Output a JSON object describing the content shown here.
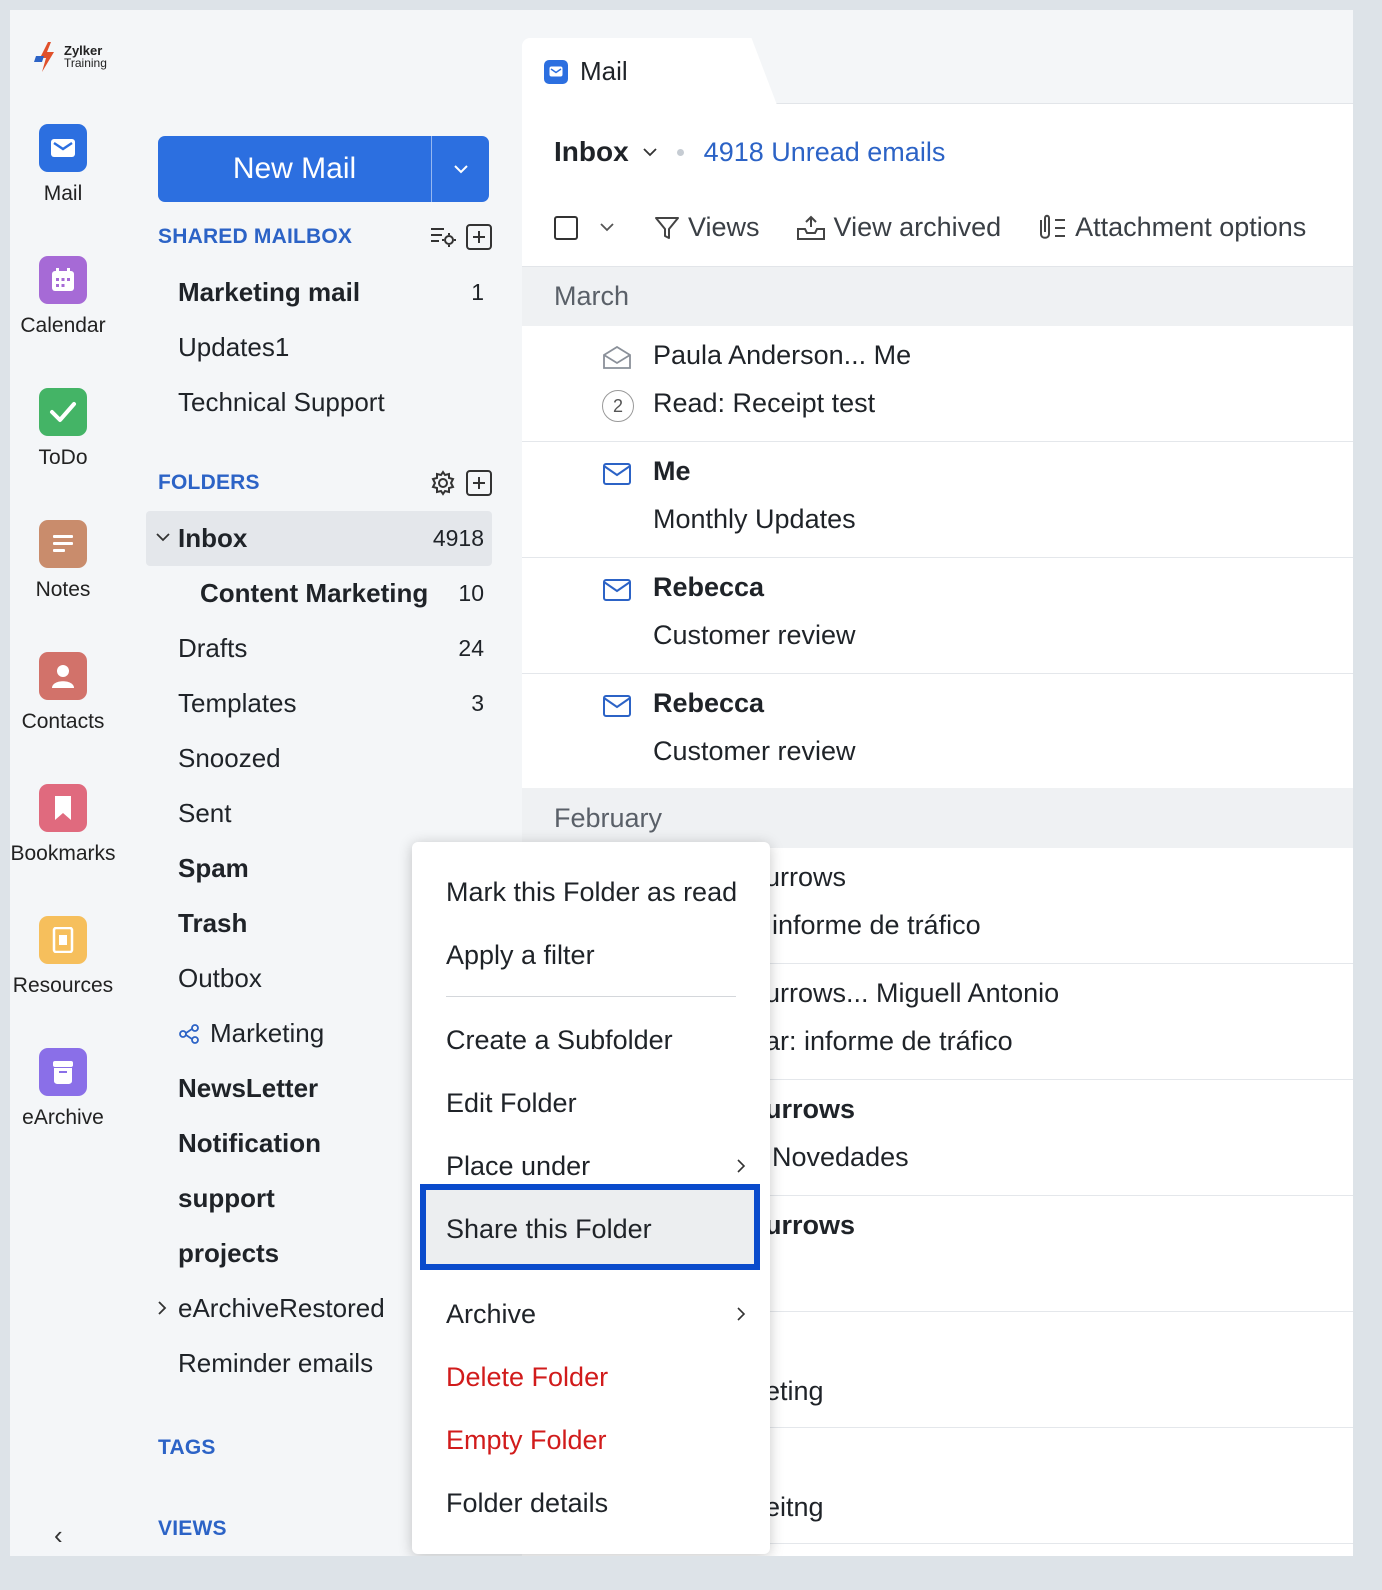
{
  "logo": {
    "line1": "Zylker",
    "line2": "Training"
  },
  "apps": [
    {
      "label": "Mail",
      "icon": "mail-icon",
      "color": "#2c6fe0"
    },
    {
      "label": "Calendar",
      "icon": "calendar-icon",
      "color": "#a66ad6"
    },
    {
      "label": "ToDo",
      "icon": "check-icon",
      "color": "#44b466"
    },
    {
      "label": "Notes",
      "icon": "notes-icon",
      "color": "#c98c6c"
    },
    {
      "label": "Contacts",
      "icon": "contact-icon",
      "color": "#d2726a"
    },
    {
      "label": "Bookmarks",
      "icon": "bookmark-icon",
      "color": "#e06a7e"
    },
    {
      "label": "Resources",
      "icon": "resources-icon",
      "color": "#f6bf5c"
    },
    {
      "label": "eArchive",
      "icon": "archive-icon",
      "color": "#8a6fe8"
    }
  ],
  "new_mail": {
    "label": "New Mail"
  },
  "shared_mailbox": {
    "heading": "SHARED MAILBOX",
    "items": [
      {
        "name": "Marketing mail",
        "count": "1"
      },
      {
        "name": "Updates1",
        "count": ""
      },
      {
        "name": "Technical Support",
        "count": ""
      }
    ]
  },
  "folders": {
    "heading": "FOLDERS",
    "items": [
      {
        "name": "Inbox",
        "count": "4918"
      },
      {
        "name": "Content Marketing",
        "count": "10"
      },
      {
        "name": "Drafts",
        "count": "24"
      },
      {
        "name": "Templates",
        "count": "3"
      },
      {
        "name": "Snoozed",
        "count": ""
      },
      {
        "name": "Sent",
        "count": ""
      },
      {
        "name": "Spam",
        "count": ""
      },
      {
        "name": "Trash",
        "count": ""
      },
      {
        "name": "Outbox",
        "count": ""
      },
      {
        "name": "Marketing",
        "count": ""
      },
      {
        "name": "NewsLetter",
        "count": ""
      },
      {
        "name": "Notification",
        "count": ""
      },
      {
        "name": "support",
        "count": ""
      },
      {
        "name": "projects",
        "count": ""
      },
      {
        "name": "eArchiveRestored",
        "count": ""
      },
      {
        "name": "Reminder emails",
        "count": ""
      }
    ]
  },
  "tags_heading": "TAGS",
  "views_heading": "VIEWS",
  "tab": {
    "label": "Mail"
  },
  "header": {
    "folder": "Inbox",
    "unread": "4918 Unread emails"
  },
  "toolbar": {
    "views": "Views",
    "archived": "View archived",
    "attachments": "Attachment options"
  },
  "groups": {
    "march": "March",
    "february": "February"
  },
  "mails": [
    {
      "sender": "Paula Anderson... Me",
      "subject": "Read: Receipt test",
      "count": "2"
    },
    {
      "sender": "Me",
      "subject": "Monthly Updates"
    },
    {
      "sender": "Rebecca",
      "subject": "Customer review"
    },
    {
      "sender": "Rebecca",
      "subject": "Customer review"
    },
    {
      "sender": "urrows",
      "subject": "informe de tráfico"
    },
    {
      "sender": "urrows... Miguell Antonio",
      "subject": "ar: informe de tráfico"
    },
    {
      "sender": "urrows",
      "subject": "Novedades"
    },
    {
      "sender": "urrows",
      "subject": ""
    },
    {
      "sender": "",
      "subject": "eting"
    },
    {
      "sender": "",
      "subject": "eitng"
    }
  ],
  "context_menu": {
    "mark_read": "Mark this Folder as read",
    "apply_filter": "Apply a filter",
    "create_subfolder": "Create a Subfolder",
    "edit": "Edit Folder",
    "place_under": "Place under",
    "share": "Share this Folder",
    "archive": "Archive",
    "delete": "Delete Folder",
    "empty": "Empty Folder",
    "details": "Folder details"
  },
  "colors": {
    "accent": "#2c6fe0",
    "highlight_border": "#0a4bcc",
    "danger": "#d11b1b"
  }
}
